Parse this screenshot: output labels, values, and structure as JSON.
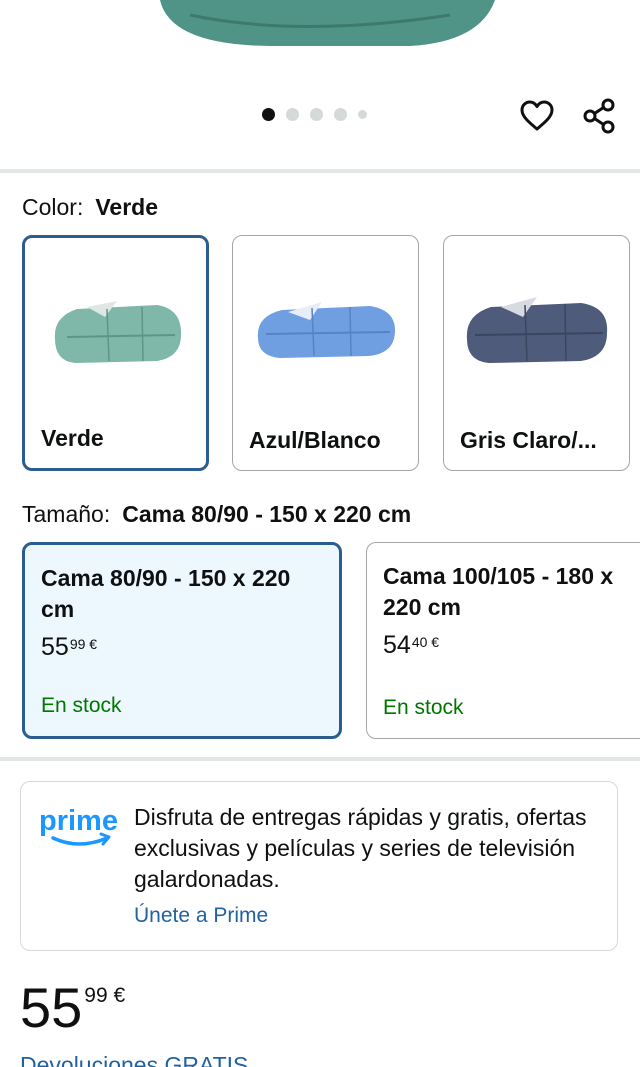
{
  "carousel": {
    "total_dots": 5,
    "active_index": 0
  },
  "color": {
    "label": "Color:",
    "selected": "Verde",
    "options": [
      {
        "name": "Verde",
        "fill": "#7fb7a8",
        "accent": "#dfe7e4"
      },
      {
        "name": "Azul/Blanco",
        "fill": "#6f9fe0",
        "accent": "#e8eef8"
      },
      {
        "name": "Gris Claro/...",
        "fill": "#4f5b7a",
        "accent": "#d7dae0"
      }
    ]
  },
  "size": {
    "label": "Tamaño:",
    "selected": "Cama 80/90 - 150 x 220 cm",
    "options": [
      {
        "title": "Cama 80/90 - 150 x 220 cm",
        "price_whole": "55",
        "price_frac": "99 €",
        "stock": "En stock"
      },
      {
        "title": "Cama 100/105 - 180 x 220 cm",
        "price_whole": "54",
        "price_frac": "40 €",
        "stock": "En stock"
      }
    ]
  },
  "prime": {
    "logo_text": "prime",
    "description": "Disfruta de entregas rápidas y gratis, ofertas exclusivas y películas y series de televisión galardonadas.",
    "link": "Únete a Prime"
  },
  "price": {
    "whole": "55",
    "fraction": "99 €"
  },
  "returns": "Devoluciones GRATIS",
  "colors": {
    "accent_border": "#2c5d8f",
    "link": "#2162a1",
    "stock": "#007600",
    "prime_blue": "#1a98ff"
  }
}
